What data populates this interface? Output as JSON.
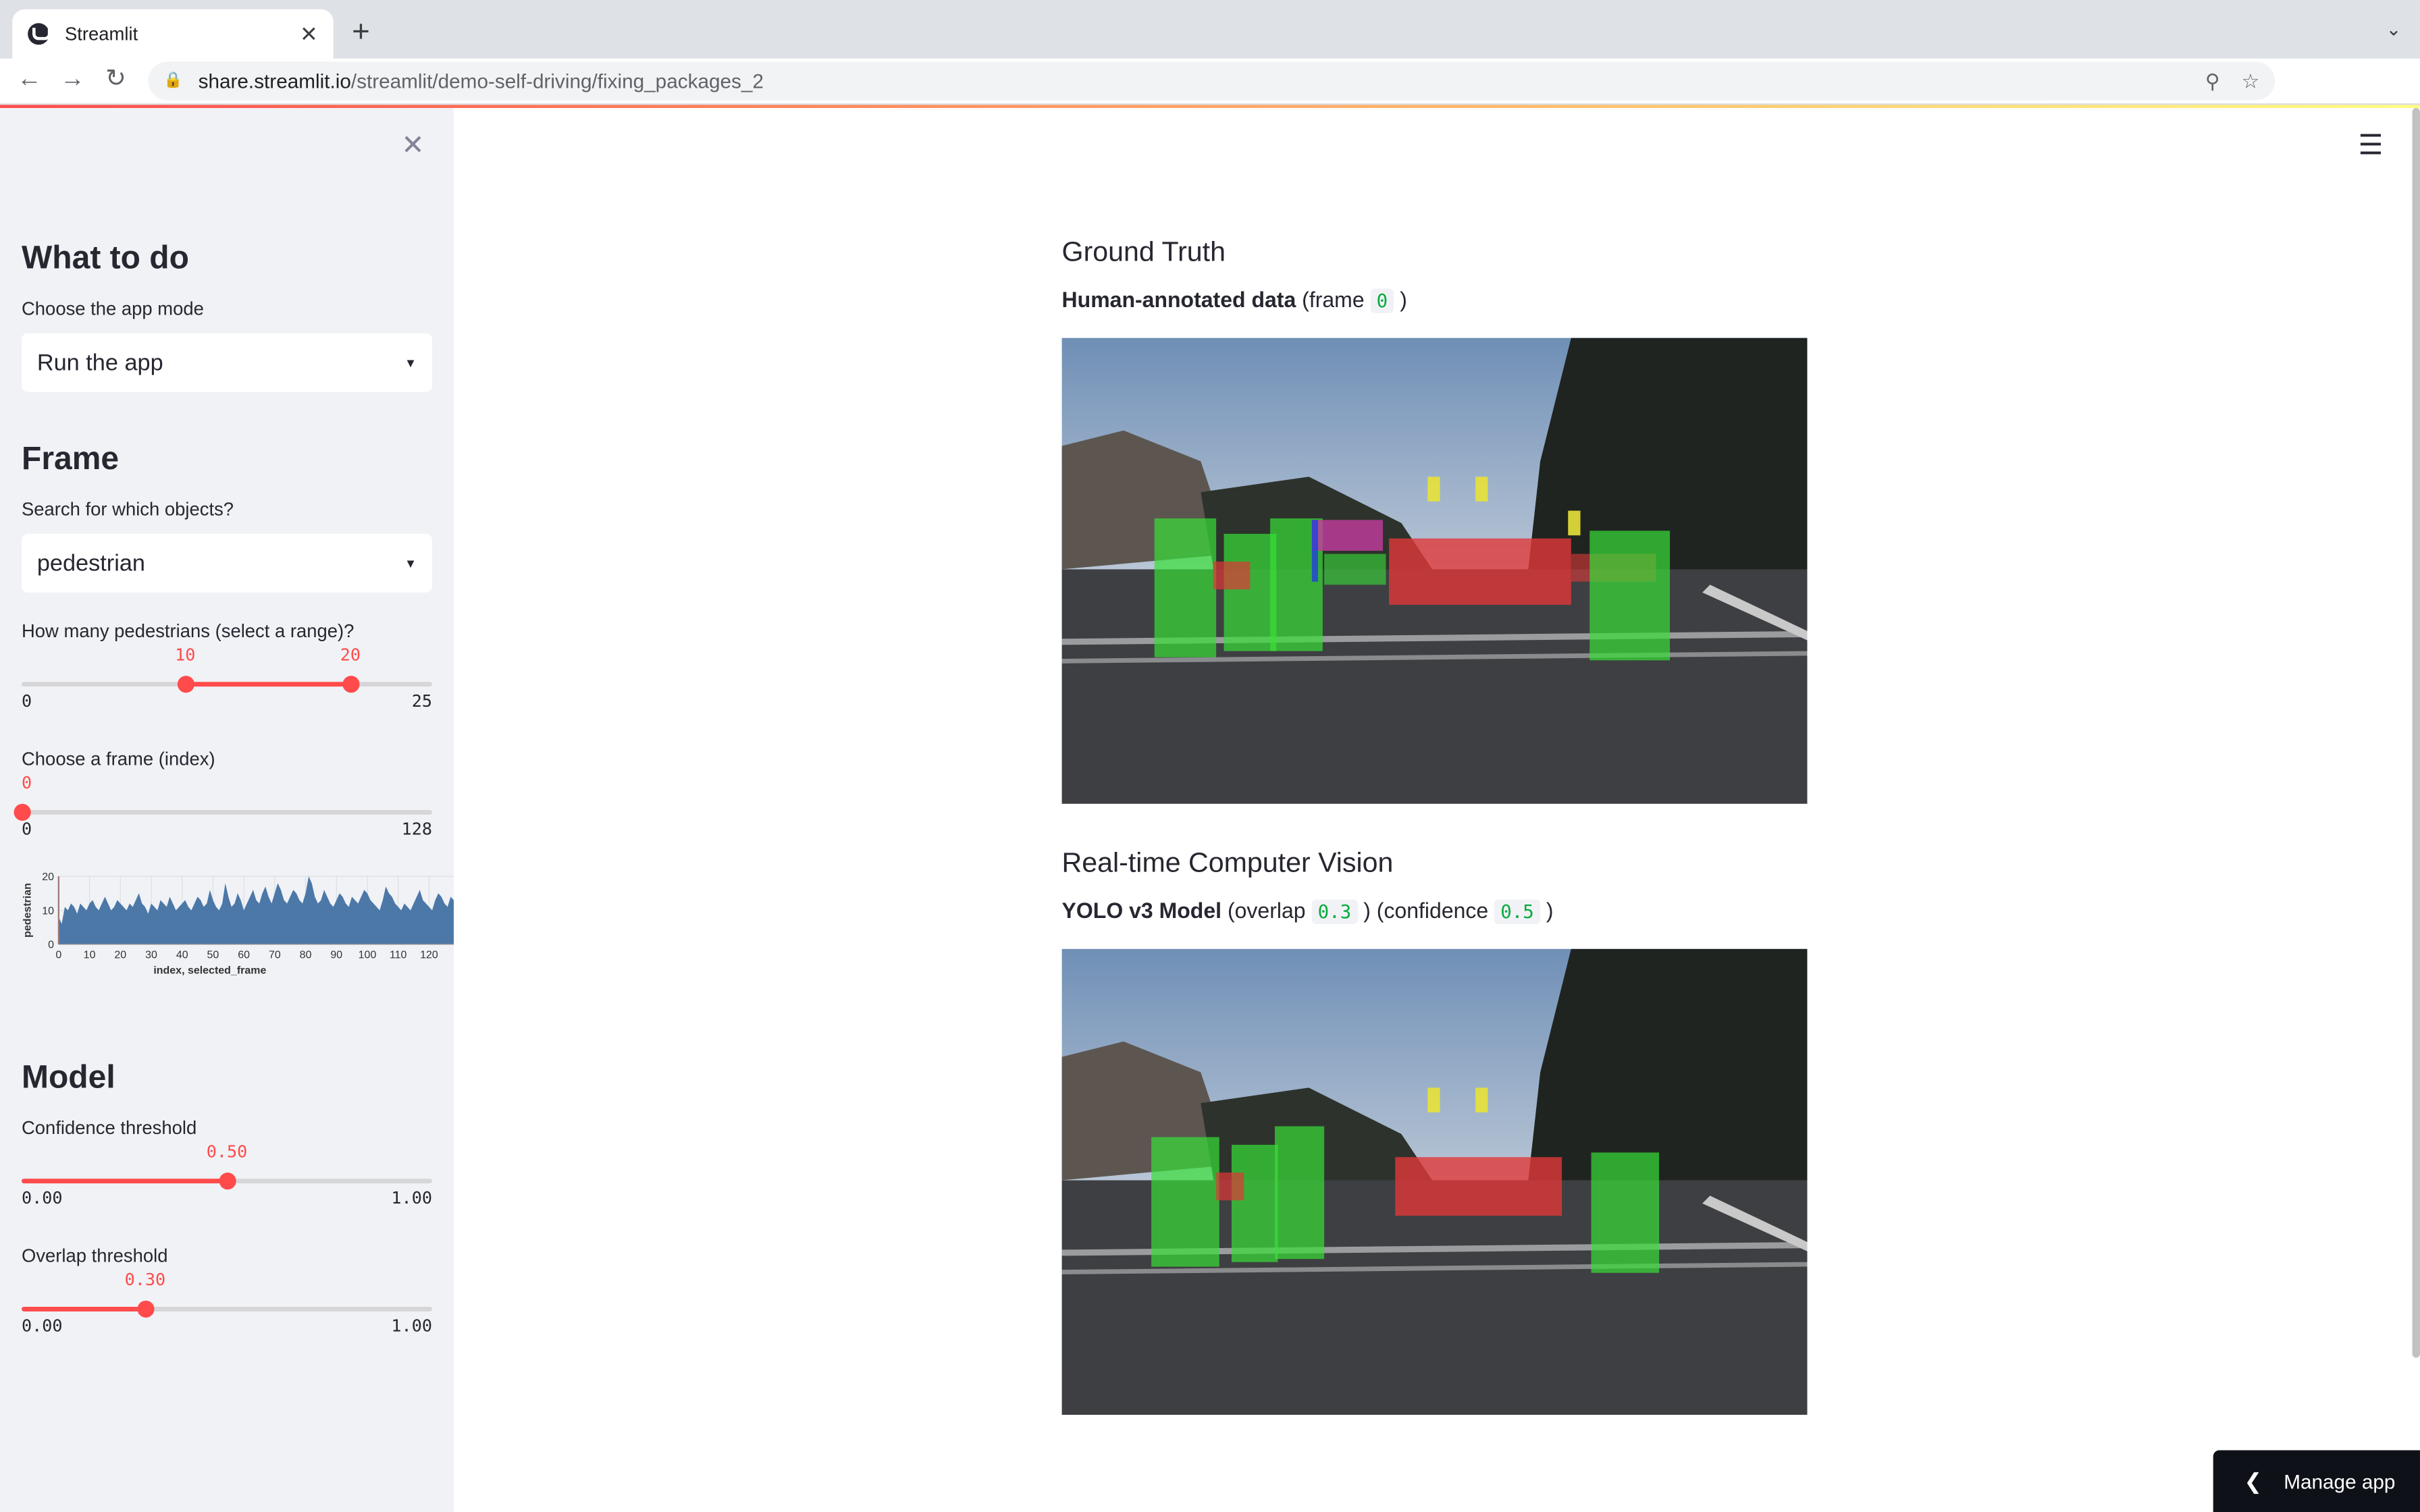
{
  "browser": {
    "tab_title": "Streamlit",
    "tab_close": "✕",
    "new_tab": "+",
    "url_host": "share.streamlit.io",
    "url_path": "/streamlit/demo-self-driving/fixing_packages_2"
  },
  "sidebar": {
    "close": "✕",
    "section_mode": "What to do",
    "mode_label": "Choose the app mode",
    "mode_value": "Run the app",
    "section_frame": "Frame",
    "objects_label": "Search for which objects?",
    "objects_value": "pedestrian",
    "range_label": "How many pedestrians (select a range)?",
    "range_low": "10",
    "range_high": "20",
    "range_min": "0",
    "range_max": "25",
    "frame_label": "Choose a frame (index)",
    "frame_value": "0",
    "frame_min": "0",
    "frame_max": "128",
    "section_model": "Model",
    "confidence_label": "Confidence threshold",
    "confidence_value": "0.50",
    "confidence_min": "0.00",
    "confidence_max": "1.00",
    "overlap_label": "Overlap threshold",
    "overlap_value": "0.30",
    "overlap_min": "0.00",
    "overlap_max": "1.00"
  },
  "chart_data": {
    "type": "area",
    "ylabel": "pedestrian",
    "xlabel": "index, selected_frame",
    "xlim": [
      0,
      128
    ],
    "ylim": [
      0,
      20
    ],
    "xticks": [
      "0",
      "10",
      "20",
      "30",
      "40",
      "50",
      "60",
      "70",
      "80",
      "90",
      "100",
      "110",
      "120"
    ],
    "yticks": [
      "0",
      "10",
      "20"
    ],
    "selected_frame": 0,
    "series": [
      {
        "values": [
          8,
          6,
          11,
          10,
          12,
          11,
          9,
          12,
          11,
          10,
          12,
          13,
          11,
          10,
          12,
          14,
          12,
          10,
          11,
          13,
          12,
          11,
          10,
          12,
          11,
          13,
          15,
          12,
          11,
          9,
          12,
          11,
          10,
          13,
          12,
          11,
          14,
          12,
          10,
          11,
          12,
          13,
          11,
          10,
          12,
          14,
          13,
          11,
          12,
          16,
          13,
          11,
          10,
          12,
          18,
          14,
          11,
          12,
          15,
          13,
          10,
          12,
          14,
          16,
          13,
          12,
          15,
          17,
          14,
          12,
          15,
          18,
          16,
          13,
          12,
          14,
          16,
          15,
          13,
          12,
          15,
          20,
          18,
          14,
          12,
          13,
          16,
          14,
          12,
          11,
          13,
          15,
          14,
          12,
          11,
          14,
          13,
          12,
          14,
          16,
          15,
          13,
          12,
          11,
          10,
          13,
          17,
          15,
          14,
          12,
          11,
          10,
          12,
          11,
          10,
          12,
          14,
          16,
          13,
          12,
          11,
          10,
          13,
          15,
          14,
          12,
          11,
          14,
          13
        ]
      }
    ]
  },
  "main": {
    "menu_icon": "☰",
    "gt_title": "Ground Truth",
    "gt_caption_bold": "Human-annotated data",
    "gt_caption_pre": "(frame",
    "gt_frame": "0",
    "gt_caption_post": ")",
    "cv_title": "Real-time Computer Vision",
    "cv_caption_bold": "YOLO v3 Model",
    "cv_overlap_pre": "(overlap",
    "cv_overlap": "0.3",
    "cv_mid": ") (confidence",
    "cv_confidence": "0.5",
    "cv_post": ")",
    "manage_app": "Manage app"
  }
}
